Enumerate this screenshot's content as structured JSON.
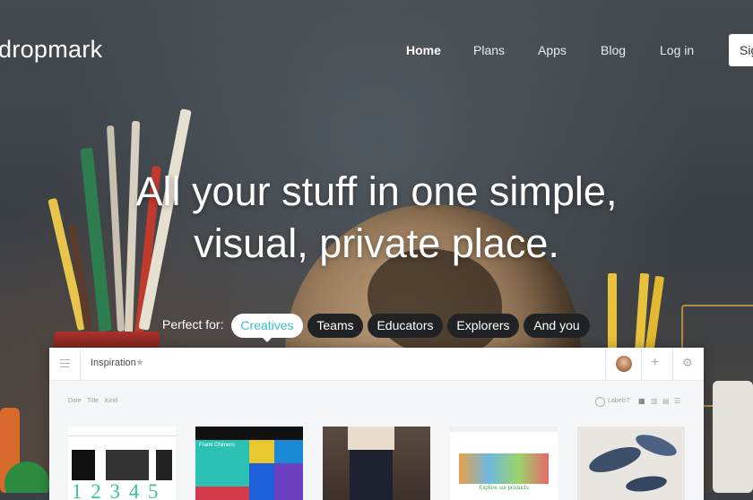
{
  "header": {
    "logo": "dropmark",
    "nav": [
      "Home",
      "Plans",
      "Apps",
      "Blog",
      "Log in"
    ],
    "signup_label": "Sig"
  },
  "hero": {
    "line1": "All your stuff in one simple,",
    "line2": "visual, private place.",
    "perfect_for": "Perfect for:",
    "audiences": [
      "Creatives",
      "Teams",
      "Educators",
      "Explorers",
      "And you"
    ],
    "active_audience": "Creatives"
  },
  "app": {
    "collection_title": "Inspiration",
    "sort_options": [
      "Date",
      "Title",
      "Kind"
    ],
    "labels_toggle": "Labels?",
    "view_icons": [
      "grid-view-icon",
      "chart-view-icon",
      "list-grid-view-icon",
      "list-view-icon"
    ],
    "cards": [
      {
        "name": "numbers-card",
        "caption": "1 2 3 4 5"
      },
      {
        "name": "frank-chimero-card",
        "caption": "Frank Chimero"
      },
      {
        "name": "jeans-photo-card",
        "caption": ""
      },
      {
        "name": "city-illustration-card",
        "caption": "Explore our products"
      },
      {
        "name": "birds-illustration-card",
        "caption": ""
      }
    ]
  },
  "colors": {
    "accent": "#3dbfcf",
    "pill_dark": "#1f2326",
    "brand_text": "#ffffff"
  }
}
